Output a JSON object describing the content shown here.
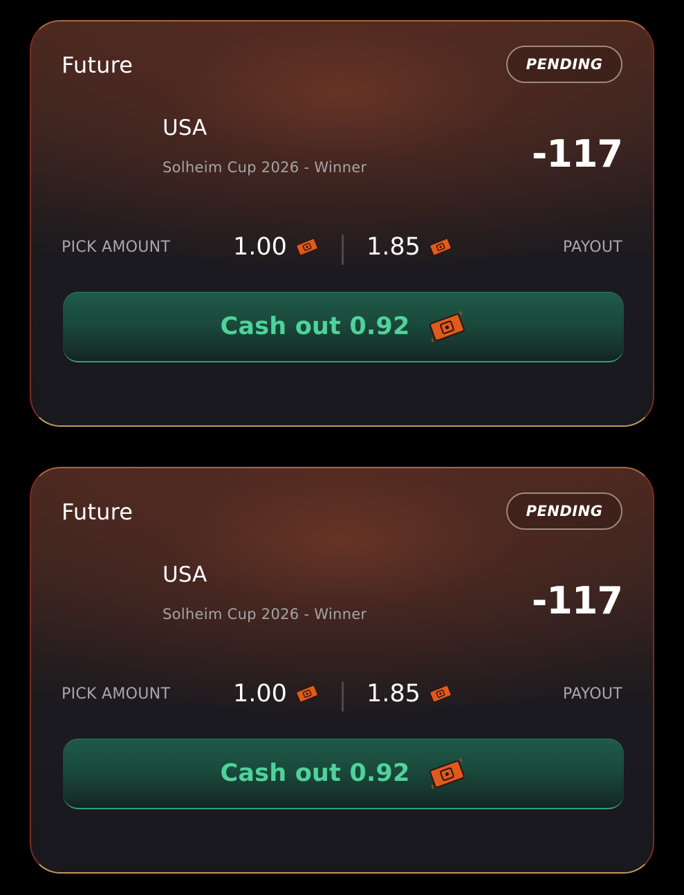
{
  "cards": [
    {
      "pick_type": "Future",
      "status": "PENDING",
      "selection": "USA",
      "market": "Solheim Cup 2026 - Winner",
      "odds": "-117",
      "pick_amount_label": "PICK AMOUNT",
      "pick_amount": "1.00",
      "payout_amount": "1.85",
      "payout_label": "PAYOUT",
      "cashout_label": "Cash out 0.92",
      "coin_icon": "coin-ticket-icon"
    },
    {
      "pick_type": "Future",
      "status": "PENDING",
      "selection": "USA",
      "market": "Solheim Cup 2026 - Winner",
      "odds": "-117",
      "pick_amount_label": "PICK AMOUNT",
      "pick_amount": "1.00",
      "payout_amount": "1.85",
      "payout_label": "PAYOUT",
      "cashout_label": "Cash out 0.92",
      "coin_icon": "coin-ticket-icon"
    }
  ],
  "colors": {
    "background": "#000000",
    "accent_green": "#4fd39a",
    "coin_orange": "#e05a1c",
    "card_border": "#7a2b22"
  }
}
